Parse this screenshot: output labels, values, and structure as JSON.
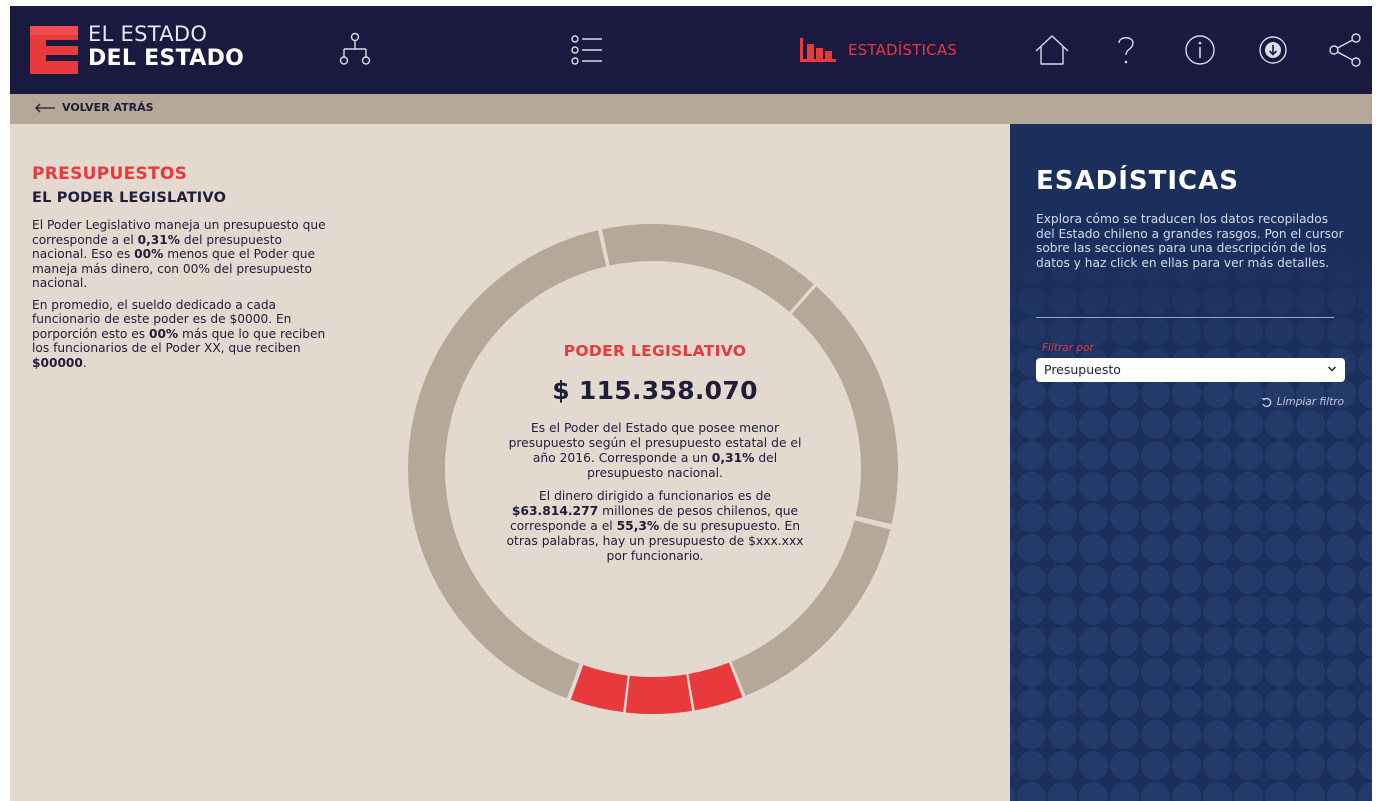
{
  "header": {
    "brand_line1": "EL ESTADO",
    "brand_line2": "DEL ESTADO",
    "logo_letter": "E",
    "nav": [
      {
        "icon": "org-chart-icon"
      },
      {
        "icon": "list-icon"
      },
      {
        "icon": "bar-chart-icon",
        "label": "ESTADÍSTICAS",
        "active": true
      },
      {
        "icon": "home-icon"
      },
      {
        "icon": "question-icon"
      },
      {
        "icon": "info-icon"
      },
      {
        "icon": "download-icon"
      },
      {
        "icon": "share-icon"
      }
    ]
  },
  "back": {
    "label": "VOLVER ATRÁS"
  },
  "left": {
    "title": "PRESUPUESTOS",
    "subtitle": "EL PODER LEGISLATIVO",
    "p1_a": "El Poder Legislativo maneja un presupuesto que corresponde a el ",
    "p1_b": "0,31%",
    "p1_c": " del presupuesto nacional. Eso es ",
    "p1_d": "00%",
    "p1_e": " menos que el Poder que maneja más dinero, con 00% del presupuesto nacional.",
    "p2_a": "En promedio, el sueldo dedicado a cada funcionario de este poder es de $0000. En porporción esto es ",
    "p2_b": "00%",
    "p2_c": " más que lo que reciben los funcionarios de el Poder XX, que reciben ",
    "p2_d": "$00000",
    "p2_e": "."
  },
  "center": {
    "title": "PODER LEGISLATIVO",
    "amount": "$ 115.358.070",
    "p1_a": "Es el Poder del Estado que posee menor presupuesto según el presupuesto estatal de el año 2016. Corresponde a un ",
    "p1_b": "0,31%",
    "p1_c": " del presupuesto nacional.",
    "p2_a": "El dinero dirigido a funcionarios es de ",
    "p2_b": "$63.814.277",
    "p2_c": " millones de pesos chilenos, que corresponde a el ",
    "p2_d": "55,3%",
    "p2_e": " de su presupuesto. En otras palabras, hay un presupuesto de $xxx.xxx por funcionario."
  },
  "right": {
    "title": "ESADÍSTICAS",
    "description": "Explora cómo se traducen los datos recopilados del Estado chileno a grandes rasgos. Pon el cursor sobre las secciones para una descripción de los datos y haz click en ellas para ver más detalles.",
    "filter_label": "Filtrar por",
    "filter_value": "Presupuesto",
    "clear_label": "Limpiar filtro"
  },
  "colors": {
    "navy": "#1a1940",
    "accent_red": "#e8393d",
    "ring_beige": "#b5a898",
    "background": "#e3d9ce",
    "panel_blue": "#1b2f5c"
  }
}
